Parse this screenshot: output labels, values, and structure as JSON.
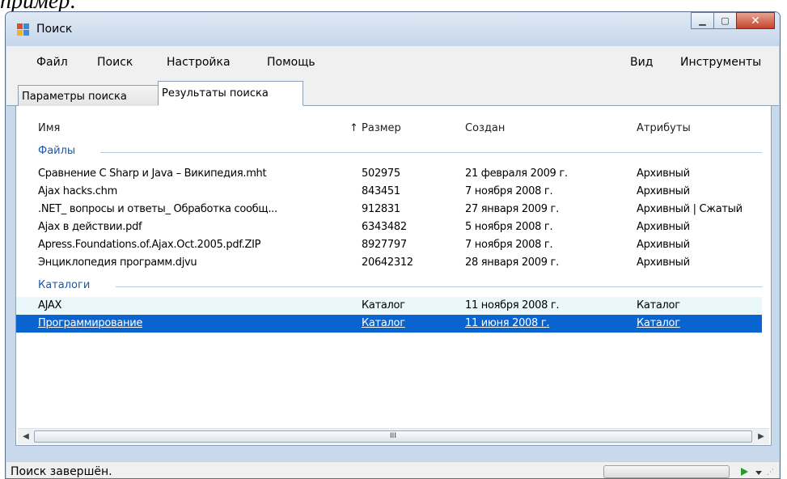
{
  "caption": "пример:",
  "window": {
    "title": "Поиск"
  },
  "menu": {
    "left": [
      "Файл",
      "Поиск",
      "Настройка",
      "Помощь"
    ],
    "right": [
      "Вид",
      "Инструменты"
    ]
  },
  "tabs": [
    {
      "label": "Параметры поиска",
      "active": false
    },
    {
      "label": "Результаты поиска",
      "active": true
    }
  ],
  "columns": [
    "Имя",
    "↑ Размер",
    "Создан",
    "Атрибуты"
  ],
  "groups": {
    "files": {
      "title": "Файлы",
      "rows": [
        [
          "Сравнение C Sharp и Java – Википедия.mht",
          "502975",
          "21 февраля 2009 г.",
          "Архивный"
        ],
        [
          "Ajax hacks.chm",
          "843451",
          "7 ноября 2008 г.",
          "Архивный"
        ],
        [
          ".NET_ вопросы и ответы_ Обработка сообщ...",
          "912831",
          "27 января 2009 г.",
          "Архивный | Сжатый"
        ],
        [
          "Ajax в действии.pdf",
          "6343482",
          "5 ноября 2008 г.",
          "Архивный"
        ],
        [
          "Apress.Foundations.of.Ajax.Oct.2005.pdf.ZIP",
          "8927797",
          "7 ноября 2008 г.",
          "Архивный"
        ],
        [
          "Энциклопедия программ.djvu",
          "20642312",
          "28 января 2009 г.",
          "Архивный"
        ]
      ]
    },
    "dirs": {
      "title": "Каталоги",
      "rows": [
        [
          "AJAX",
          "Каталог",
          "11 ноября 2008 г.",
          "Каталог"
        ],
        [
          "Программирование",
          "Каталог",
          "11 июня 2008 г.",
          "Каталог"
        ]
      ]
    }
  },
  "scrollbar": {
    "thumb_label": "III"
  },
  "status": {
    "text": "Поиск завершён."
  },
  "colors": {
    "selection": "#0a64d0",
    "group_title": "#1e58a8",
    "alt_row": "#eaf7fb"
  }
}
